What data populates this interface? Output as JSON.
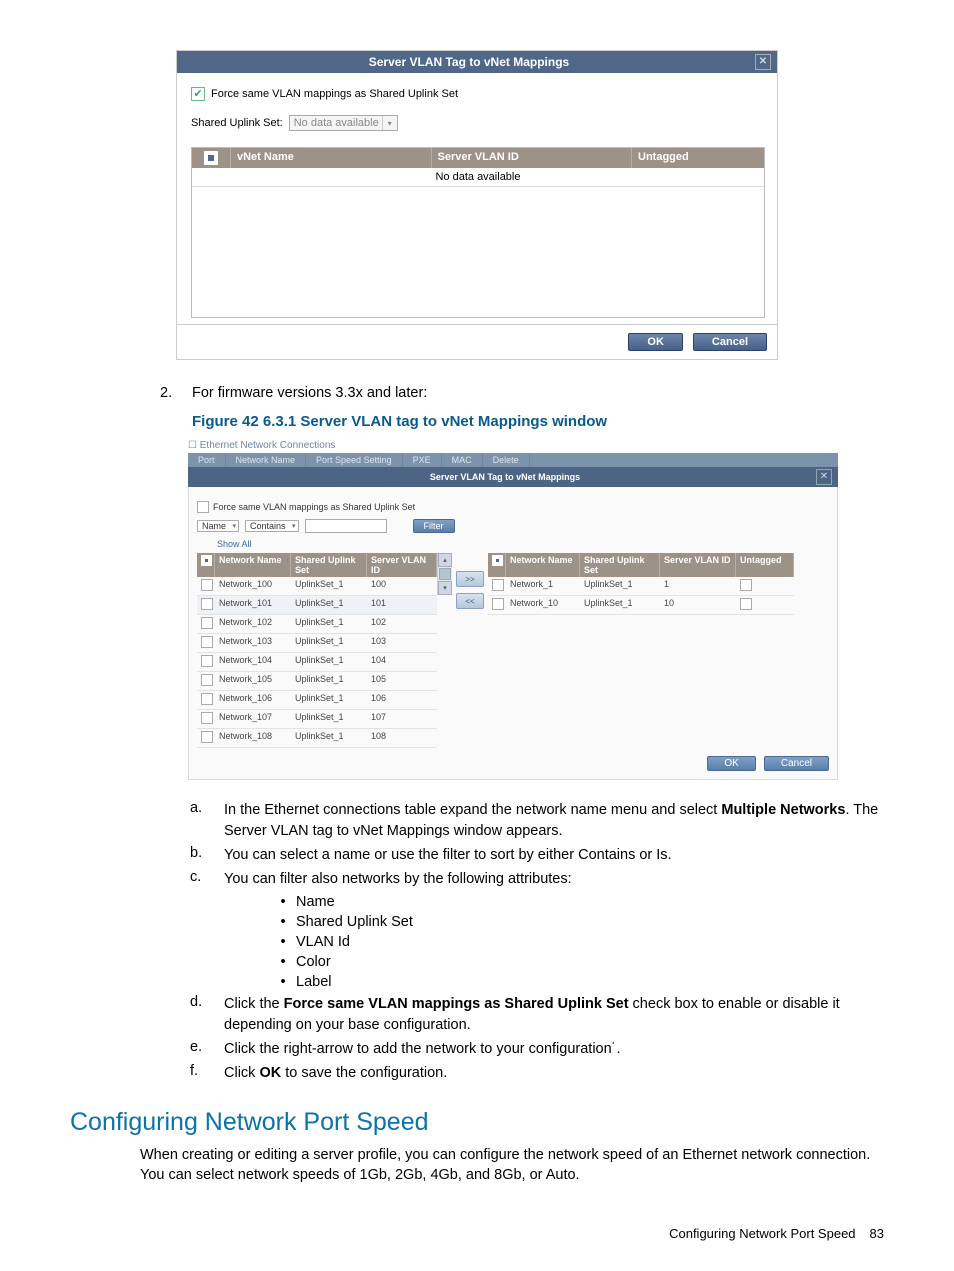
{
  "dialog1": {
    "title": "Server VLAN Tag to vNet Mappings",
    "force_label": "Force same VLAN mappings as Shared Uplink Set",
    "sus_label": "Shared Uplink Set:",
    "sus_value": "No data available",
    "cols": {
      "vnet": "vNet Name",
      "svid": "Server VLAN ID",
      "untagged": "Untagged"
    },
    "nodata": "No data available",
    "ok": "OK",
    "cancel": "Cancel"
  },
  "step2": {
    "num": "2.",
    "text": "For firmware versions 3.3x and later:"
  },
  "figure_caption": "Figure 42 6.3.1 Server VLAN tag to vNet Mappings window",
  "dialog2": {
    "win_title": "Ethernet Network Connections",
    "tabs": [
      "Port",
      "Network Name",
      "Port Speed Setting",
      "PXE",
      "MAC",
      "Delete"
    ],
    "band_title": "Server VLAN Tag to vNet Mappings",
    "force_label": "Force same VLAN mappings as Shared Uplink Set",
    "filter_field_label": "Name",
    "filter_op": "Contains",
    "filter_btn": "Filter",
    "showall": "Show All",
    "left_cols": [
      "",
      "Network Name",
      "Shared Uplink Set",
      "Server VLAN ID"
    ],
    "left_rows": [
      {
        "name": "Network_100",
        "sus": "UplinkSet_1",
        "vid": "100"
      },
      {
        "name": "Network_101",
        "sus": "UplinkSet_1",
        "vid": "101"
      },
      {
        "name": "Network_102",
        "sus": "UplinkSet_1",
        "vid": "102"
      },
      {
        "name": "Network_103",
        "sus": "UplinkSet_1",
        "vid": "103"
      },
      {
        "name": "Network_104",
        "sus": "UplinkSet_1",
        "vid": "104"
      },
      {
        "name": "Network_105",
        "sus": "UplinkSet_1",
        "vid": "105"
      },
      {
        "name": "Network_106",
        "sus": "UplinkSet_1",
        "vid": "106"
      },
      {
        "name": "Network_107",
        "sus": "UplinkSet_1",
        "vid": "107"
      },
      {
        "name": "Network_108",
        "sus": "UplinkSet_1",
        "vid": "108"
      }
    ],
    "right_cols": [
      "",
      "Network Name",
      "Shared Uplink Set",
      "Server VLAN ID",
      "Untagged"
    ],
    "right_rows": [
      {
        "name": "Network_1",
        "sus": "UplinkSet_1",
        "vid": "1"
      },
      {
        "name": "Network_10",
        "sus": "UplinkSet_1",
        "vid": "10"
      }
    ],
    "arrow_right": ">>",
    "arrow_left": "<<",
    "ok": "OK",
    "cancel": "Cancel"
  },
  "steps_alpha": {
    "a_label": "a.",
    "a_pre": "In the Ethernet connections table expand the network name menu and select ",
    "a_bold": "Multiple Networks",
    "a_post": ". The Server VLAN tag to vNet Mappings window appears.",
    "b_label": "b.",
    "b": "You can select a name or use the filter to sort by either Contains or Is.",
    "c_label": "c.",
    "c": "You can filter also networks by the following attributes:",
    "bullets": [
      "Name",
      "Shared Uplink Set",
      "VLAN Id",
      "Color",
      "Label"
    ],
    "d_label": "d.",
    "d_pre": "Click the ",
    "d_bold": "Force same VLAN mappings as Shared Uplink Set",
    "d_post": " check box to enable or disable it depending on your base configuration.",
    "e_label": "e.",
    "e": "Click the right-arrow to add the network to your configuration˙.",
    "f_label": "f.",
    "f_pre": "Click ",
    "f_bold": "OK",
    "f_post": " to save the configuration."
  },
  "section_heading": "Configuring Network Port Speed",
  "section_body": "When creating or editing a server profile, you can configure the network speed of an Ethernet network connection. You can select network speeds of 1Gb, 2Gb, 4Gb, and 8Gb, or Auto.",
  "footer": {
    "label": "Configuring Network Port Speed",
    "page": "83"
  }
}
